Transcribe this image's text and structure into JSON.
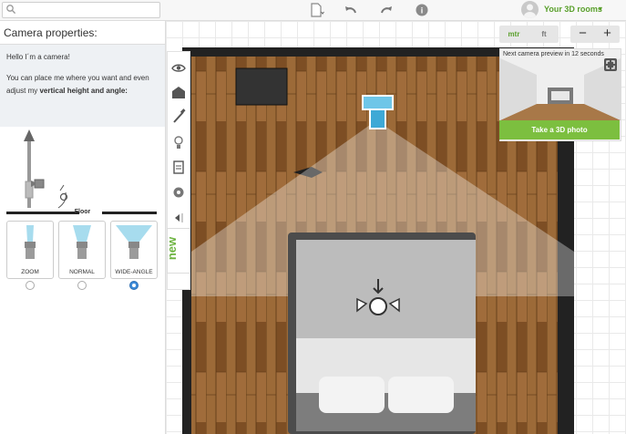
{
  "topbar": {
    "search_placeholder": "",
    "user_label": "Your 3D rooms",
    "user_caret": "▾",
    "accent": "#5aa02c"
  },
  "panel": {
    "title": "Camera properties:",
    "intro_line1": "Hello I´m a camera!",
    "intro_line2": "You can place me where you want and even",
    "intro_line3_prefix": "adjust my ",
    "intro_line3_bold": "vertical height and angle:",
    "floor_label": "Floor",
    "lenses": [
      {
        "label": "ZOOM",
        "selected": false
      },
      {
        "label": "NORMAL",
        "selected": false
      },
      {
        "label": "WIDE-ANGLE",
        "selected": true
      }
    ]
  },
  "side_tab": {
    "label": "new"
  },
  "units": {
    "metric": "mtr",
    "imperial": "ft"
  },
  "zoom": {
    "out": "−",
    "in": "+"
  },
  "preview": {
    "label": "Next camera preview in 12 seconds",
    "button": "Take a 3D photo",
    "button_color": "#7cbf3f"
  },
  "icons": {
    "search": "search-icon",
    "document": "document-icon",
    "undo": "undo-icon",
    "redo": "redo-icon",
    "help": "help-icon",
    "avatar": "avatar",
    "eye": "eye-icon",
    "furniture": "furniture-icon",
    "paint": "paint-brush-icon",
    "lamp": "lamp-icon",
    "clipboard": "clipboard-icon",
    "settings": "gear-icon",
    "collapse": "collapse-panel-icon"
  }
}
